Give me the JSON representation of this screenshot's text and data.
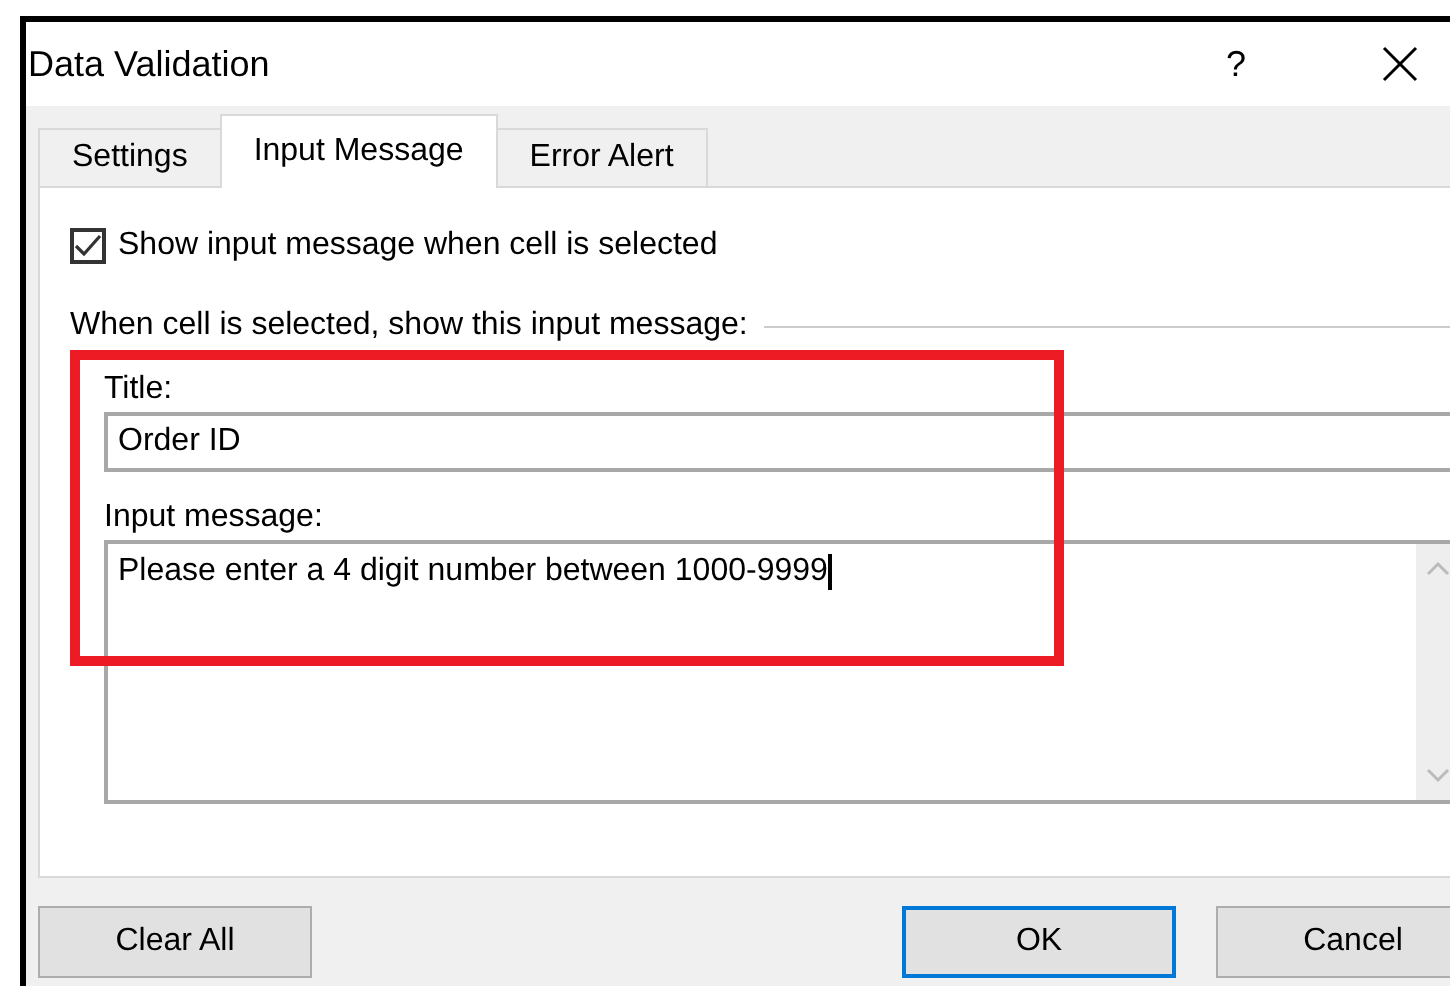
{
  "window": {
    "title": "Data Validation",
    "help": "?"
  },
  "tabs": [
    {
      "label": "Settings",
      "selected": false
    },
    {
      "label": "Input Message",
      "selected": true
    },
    {
      "label": "Error Alert",
      "selected": false
    }
  ],
  "show_message": {
    "label": "Show input message when cell is selected",
    "checked": true
  },
  "section_label": "When cell is selected, show this input message:",
  "title_field": {
    "label": "Title:",
    "value": "Order ID"
  },
  "message_field": {
    "label": "Input message:",
    "value": "Please enter a 4 digit number between 1000-9999"
  },
  "buttons": [
    {
      "label": "Clear All",
      "kind": "left",
      "default": false
    },
    {
      "label": "OK",
      "kind": "right",
      "default": true
    },
    {
      "label": "Cancel",
      "kind": "right",
      "default": false
    }
  ]
}
